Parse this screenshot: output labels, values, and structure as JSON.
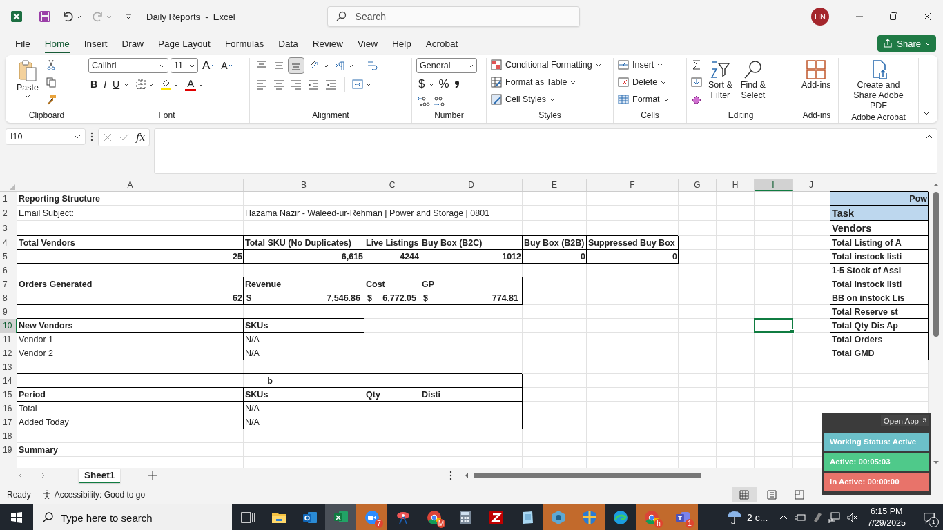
{
  "title_bar": {
    "title": "Daily Reports  -  Excel",
    "search": {
      "placeholder": "Search"
    },
    "avatar": "HN"
  },
  "menu_tabs": [
    {
      "label": "File",
      "selected": false
    },
    {
      "label": "Home",
      "selected": true
    },
    {
      "label": "Insert",
      "selected": false
    },
    {
      "label": "Draw",
      "selected": false
    },
    {
      "label": "Page Layout",
      "selected": false
    },
    {
      "label": "Formulas",
      "selected": false
    },
    {
      "label": "Data",
      "selected": false
    },
    {
      "label": "Review",
      "selected": false
    },
    {
      "label": "View",
      "selected": false
    },
    {
      "label": "Help",
      "selected": false
    },
    {
      "label": "Acrobat",
      "selected": false
    }
  ],
  "share_button": "Share",
  "ribbon": {
    "clipboard": {
      "paste": "Paste",
      "label": "Clipboard"
    },
    "font": {
      "name": "Calibri",
      "size": "11",
      "grow": "A",
      "shrink": "A",
      "bold": "B",
      "italic": "I",
      "underline": "U",
      "font_color_button": "A",
      "label": "Font"
    },
    "alignment": {
      "buttons": [
        {
          "kind": "top",
          "selected": false
        },
        {
          "kind": "middle",
          "selected": false
        },
        {
          "kind": "bottom",
          "selected": true
        }
      ],
      "label": "Alignment"
    },
    "number": {
      "format": "General",
      "currency": "$",
      "percent": "%",
      "label": "Number"
    },
    "styles": {
      "items": [
        {
          "kind": "conditional",
          "label": "Conditional Formatting"
        },
        {
          "kind": "table",
          "label": "Format as Table"
        },
        {
          "kind": "cellstyles",
          "label": "Cell Styles"
        }
      ],
      "label": "Styles"
    },
    "cells": {
      "items": [
        {
          "kind": "insert",
          "label": "Insert"
        },
        {
          "kind": "delete",
          "label": "Delete"
        },
        {
          "kind": "format",
          "label": "Format"
        }
      ],
      "label": "Cells"
    },
    "editing": {
      "sort": [
        "Sort &",
        "Filter"
      ],
      "find": [
        "Find &",
        "Select"
      ],
      "label": "Editing"
    },
    "addins": {
      "button": "Add-ins",
      "label": "Add-ins"
    },
    "acrobat": {
      "button": "Create and Share Adobe PDF",
      "label": "Adobe Acrobat"
    }
  },
  "formula_bar": {
    "name_box": "I10",
    "fx": "fx"
  },
  "grid": {
    "columns": [
      {
        "label": "A",
        "selected": false
      },
      {
        "label": "B",
        "selected": false
      },
      {
        "label": "C",
        "selected": false
      },
      {
        "label": "D",
        "selected": false
      },
      {
        "label": "E",
        "selected": false
      },
      {
        "label": "F",
        "selected": false
      },
      {
        "label": "G",
        "selected": false
      },
      {
        "label": "H",
        "selected": false
      },
      {
        "label": "I",
        "selected": true
      },
      {
        "label": "J",
        "selected": false
      }
    ],
    "rows": [
      {
        "label": "1",
        "selected": false,
        "cells": {
          "A": {
            "text": "Reporting Structure",
            "bold": true
          },
          "K": {
            "text": "Pow",
            "bold": true,
            "right": true,
            "kind": "header",
            "boxed": true
          }
        }
      },
      {
        "label": "2",
        "selected": false,
        "cells": {
          "A": {
            "text": "Email Subject:"
          },
          "B": {
            "text": "Hazama Nazir - Waleed-ur-Rehman | Power and Storage | 0801"
          },
          "K": {
            "text": "Task",
            "bold": true,
            "kind": "header-large",
            "boxed": true
          }
        }
      },
      {
        "label": "3",
        "selected": false,
        "cells": {
          "K": {
            "text": "Vendors",
            "bold": true,
            "kind": "large",
            "boxed": true
          }
        }
      },
      {
        "label": "4",
        "selected": false,
        "cells": {
          "A": {
            "text": "Total Vendors",
            "bold": true,
            "boxed": true
          },
          "B": {
            "text": "Total SKU (No Duplicates)",
            "bold": true,
            "boxed": true
          },
          "C": {
            "text": "Live Listings",
            "bold": true,
            "boxed": true
          },
          "D": {
            "text": "Buy Box (B2C)",
            "bold": true,
            "boxed": true
          },
          "E": {
            "text": "Buy Box (B2B)",
            "bold": true,
            "boxed": true
          },
          "F": {
            "text": "Suppressed Buy Box",
            "bold": true,
            "boxed": true
          },
          "K": {
            "text": "Total Listing of A",
            "bold": true,
            "boxed": true
          }
        }
      },
      {
        "label": "5",
        "selected": false,
        "cells": {
          "A": {
            "text": "25",
            "bold": true,
            "right": true,
            "boxed": true
          },
          "B": {
            "text": "6,615",
            "bold": true,
            "right": true,
            "boxed": true
          },
          "C": {
            "text": "4244",
            "bold": true,
            "right": true,
            "boxed": true
          },
          "D": {
            "text": "1012",
            "bold": true,
            "right": true,
            "boxed": true
          },
          "E": {
            "text": "0",
            "bold": true,
            "right": true,
            "boxed": true
          },
          "F": {
            "text": "0",
            "bold": true,
            "right": true,
            "boxed": true
          },
          "K": {
            "text": "Total instock listi",
            "bold": true,
            "boxed": true
          }
        }
      },
      {
        "label": "6",
        "selected": false,
        "cells": {
          "K": {
            "text": "1-5 Stock of Assi",
            "bold": true,
            "boxed": true
          }
        }
      },
      {
        "label": "7",
        "selected": false,
        "cells": {
          "A": {
            "text": "Orders Generated",
            "bold": true,
            "boxed": true
          },
          "B": {
            "text": "Revenue",
            "bold": true,
            "boxed": true
          },
          "C": {
            "text": "Cost",
            "bold": true,
            "boxed": true
          },
          "D": {
            "text": "GP",
            "bold": true,
            "boxed": true
          },
          "K": {
            "text": "Total instock listi",
            "bold": true,
            "boxed": true
          }
        }
      },
      {
        "label": "8",
        "selected": false,
        "cells": {
          "A": {
            "text": "62",
            "bold": true,
            "right": true,
            "boxed": true
          },
          "B": {
            "currency": "$",
            "text": "7,546.86",
            "bold": true,
            "boxed": true
          },
          "C": {
            "currency": "$",
            "text": "6,772.05",
            "bold": true,
            "boxed": true
          },
          "D": {
            "currency": "$",
            "text": "774.81",
            "bold": true,
            "boxed": true
          },
          "K": {
            "text": "BB on instock Lis",
            "bold": true,
            "boxed": true
          }
        }
      },
      {
        "label": "9",
        "selected": false,
        "cells": {
          "K": {
            "text": "Total Reserve st",
            "bold": true,
            "boxed": true
          }
        }
      },
      {
        "label": "10",
        "selected": true,
        "cells": {
          "A": {
            "text": "New Vendors",
            "bold": true,
            "boxed": true
          },
          "B": {
            "text": "SKUs",
            "bold": true,
            "boxed": true
          },
          "K": {
            "text": "Total Qty Dis Ap",
            "bold": true,
            "boxed": true
          }
        }
      },
      {
        "label": "11",
        "selected": false,
        "cells": {
          "A": {
            "text": "Vendor 1",
            "boxed": true
          },
          "B": {
            "text": "N/A",
            "boxed": true
          },
          "K": {
            "text": "Total Orders",
            "bold": true,
            "boxed": true
          }
        }
      },
      {
        "label": "12",
        "selected": false,
        "cells": {
          "A": {
            "text": "Vendor 2",
            "boxed": true
          },
          "B": {
            "text": "N/A",
            "boxed": true
          },
          "K": {
            "text": "Total GMD",
            "bold": true,
            "boxed": true
          }
        }
      },
      {
        "label": "13",
        "selected": false
      },
      {
        "label": "14",
        "selected": false,
        "cells": {
          "A": {
            "text": "b",
            "bold": true,
            "centered": true,
            "boxed": true
          },
          "B": {
            "merged": true
          },
          "C": {
            "merged": true
          },
          "D": {
            "merged": true
          }
        }
      },
      {
        "label": "15",
        "selected": false,
        "cells": {
          "A": {
            "text": "Period",
            "bold": true,
            "boxed": true
          },
          "B": {
            "text": "SKUs",
            "bold": true,
            "boxed": true
          },
          "C": {
            "text": "Qty",
            "bold": true,
            "boxed": true
          },
          "D": {
            "text": "Disti",
            "bold": true,
            "boxed": true
          }
        }
      },
      {
        "label": "16",
        "selected": false,
        "cells": {
          "A": {
            "text": "Total",
            "boxed": true
          },
          "B": {
            "text": "N/A",
            "boxed": true
          },
          "D": {
            "boxed": true
          }
        }
      },
      {
        "label": "17",
        "selected": false,
        "cells": {
          "A": {
            "text": "Added Today",
            "boxed": true
          },
          "B": {
            "text": "N/A",
            "boxed": true
          },
          "C": {
            "boxed": true
          },
          "D": {
            "boxed": true
          }
        }
      },
      {
        "label": "18",
        "selected": false
      },
      {
        "label": "19",
        "selected": false,
        "cells": {
          "A": {
            "text": "Summary",
            "bold": true
          }
        }
      }
    ]
  },
  "sheet_tabs": [
    {
      "label": "Sheet1",
      "selected": true
    }
  ],
  "status_bar": {
    "ready": "Ready",
    "accessibility": "Accessibility: Good to go",
    "views": [
      {
        "kind": "normal",
        "selected": true
      },
      {
        "kind": "page-layout",
        "selected": false
      },
      {
        "kind": "page-break",
        "selected": false
      }
    ]
  },
  "tracker": {
    "open_app": "Open App",
    "statuses": [
      {
        "label": "Working Status: Active",
        "color": "#6cc0c9"
      },
      {
        "label": "Active: 00:05:03",
        "color": "#4fc98a"
      },
      {
        "label": "In Active: 00:00:00",
        "color": "#e8736a"
      }
    ]
  },
  "taskbar": {
    "search": {
      "placeholder": "Type here to search"
    },
    "apps": [
      {
        "kind": "task-view",
        "active": false,
        "flashing": false
      },
      {
        "kind": "folder",
        "active": false,
        "flashing": false
      },
      {
        "kind": "mail",
        "active": false,
        "flashing": false
      },
      {
        "kind": "sheet",
        "active": true,
        "flashing": false
      },
      {
        "kind": "video",
        "active": false,
        "flashing": true,
        "badge": "7"
      },
      {
        "kind": "pinwheel",
        "active": false,
        "flashing": false
      },
      {
        "kind": "browser",
        "active": false,
        "flashing": false,
        "badge": "M"
      },
      {
        "kind": "calculator",
        "active": false,
        "flashing": false
      },
      {
        "kind": "zigzag",
        "active": false,
        "flashing": false
      },
      {
        "kind": "notepad",
        "active": false,
        "flashing": false
      },
      {
        "kind": "hexagon",
        "active": false,
        "flashing": true
      },
      {
        "kind": "shield",
        "active": false,
        "flashing": true
      },
      {
        "kind": "swirl",
        "active": false,
        "flashing": false
      },
      {
        "kind": "browser",
        "active": false,
        "flashing": true,
        "badge": "h"
      },
      {
        "kind": "chat",
        "active": false,
        "flashing": true,
        "badge": "1"
      }
    ],
    "weather": "2 c...",
    "time": "6:15 PM",
    "date": "7/29/2025",
    "notifications": "1"
  }
}
